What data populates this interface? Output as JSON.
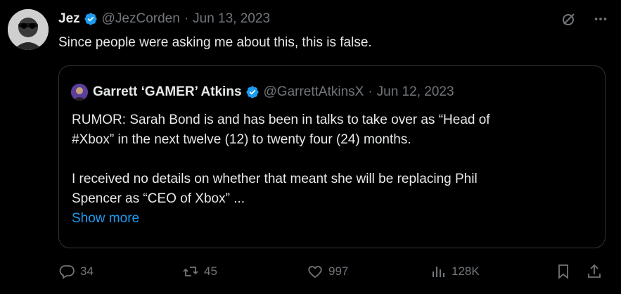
{
  "tweet": {
    "author_name": "Jez",
    "handle": "@JezCorden",
    "date": "Jun 13, 2023",
    "separator": "·",
    "text": "Since people were asking me about this, this is false."
  },
  "quote": {
    "author_name": "Garrett ‘GAMER’ Atkins",
    "handle": "@GarrettAtkinsX",
    "date": "Jun 12, 2023",
    "separator": "·",
    "lines": [
      "RUMOR: Sarah Bond is and has been in talks to take over as “Head of",
      "#Xbox” in the next twelve (12) to twenty four (24) months.",
      "",
      "I received no details on whether that meant she will be replacing Phil",
      "Spencer as “CEO of Xbox” ..."
    ],
    "show_more": "Show more"
  },
  "actions": {
    "replies": "34",
    "reposts": "45",
    "likes": "997",
    "views": "128K"
  },
  "colors": {
    "background": "#000000",
    "text": "#e7e9ea",
    "muted": "#71767b",
    "accent": "#1d9bf0",
    "border": "#2f3336"
  },
  "icons": {
    "verified": "verified-badge-icon",
    "grok": "grok-icon",
    "more": "more-icon",
    "reply": "reply-icon",
    "repost": "repost-icon",
    "like": "like-icon",
    "views": "views-icon",
    "bookmark": "bookmark-icon",
    "share": "share-icon"
  }
}
